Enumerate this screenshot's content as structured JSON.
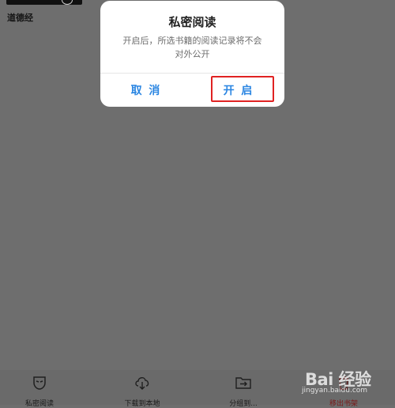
{
  "background": {
    "book_title": "道德经"
  },
  "dialog": {
    "title": "私密阅读",
    "message_line1": "开启后，所选书籍的阅读记录将不会",
    "message_line2": "对外公开",
    "cancel_label": "取 消",
    "enable_label": "开 启",
    "accent_color": "#2b86e2",
    "highlight_color": "#e02222"
  },
  "toolbar": {
    "items": [
      {
        "label": "私密阅读",
        "icon": "mask-icon"
      },
      {
        "label": "下载到本地",
        "icon": "cloud-download-icon"
      },
      {
        "label": "分组到...",
        "icon": "folder-move-icon"
      },
      {
        "label": "移出书架",
        "icon": "trash-icon"
      }
    ]
  },
  "watermark": {
    "brand": "Bai 经验",
    "url": "jingyan.baidu.com"
  }
}
